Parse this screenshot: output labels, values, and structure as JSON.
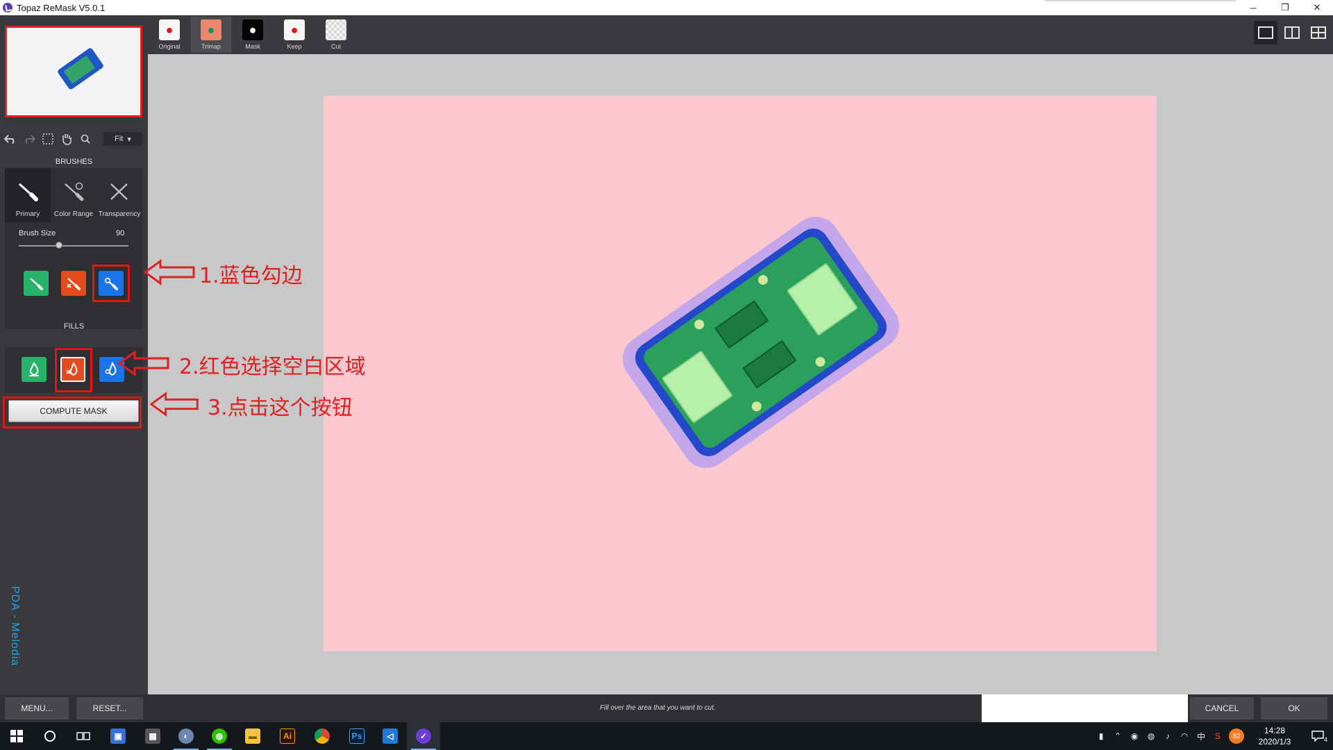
{
  "window": {
    "title": "Topaz ReMask V5.0.1",
    "minimize": "─",
    "restore": "❐",
    "close": "✕"
  },
  "sidebar": {
    "zoom_select": "Fit",
    "zoom_arrow": "▾",
    "brushes_heading": "BRUSHES",
    "brush_tabs": [
      "Primary",
      "Color Range",
      "Transparency"
    ],
    "brush_size_label": "Brush Size",
    "brush_size_value": "90",
    "brush_size_fraction": 0.37,
    "fills_heading": "FILLS",
    "compute_mask": "COMPUTE MASK",
    "watermark": "PDA - Melodia"
  },
  "view_tabs": [
    "Original",
    "Trimap",
    "Mask",
    "Keep",
    "Cut"
  ],
  "active_view": "Trimap",
  "annotations": {
    "step1": "1.蓝色勾边",
    "step2": "2.红色选择空白区域",
    "step3": "3.点击这个按钮"
  },
  "bottom": {
    "menu": "MENU...",
    "reset": "RESET...",
    "hint": "Fill over the area that you want to cut.",
    "cancel": "CANCEL",
    "ok": "OK"
  },
  "taskbar": {
    "time": "14:28",
    "date": "2020/1/3",
    "ime": "中",
    "badge": "82",
    "notif_count": "4",
    "apps": [
      "start",
      "cortana",
      "task-view",
      "app-blue",
      "calculator",
      "remote-app",
      "wechat",
      "file-explorer",
      "illustrator",
      "chrome",
      "photoshop",
      "vscode",
      "topaz-remask"
    ],
    "labels": {
      "ai": "Ai",
      "ps": "Ps"
    }
  },
  "colors": {
    "keep_green": "#27b36a",
    "cut_red": "#e54a1f",
    "edge_blue": "#1b73e8",
    "annotation_red": "#e02020",
    "trimap_pink": "#fbc8d0"
  }
}
